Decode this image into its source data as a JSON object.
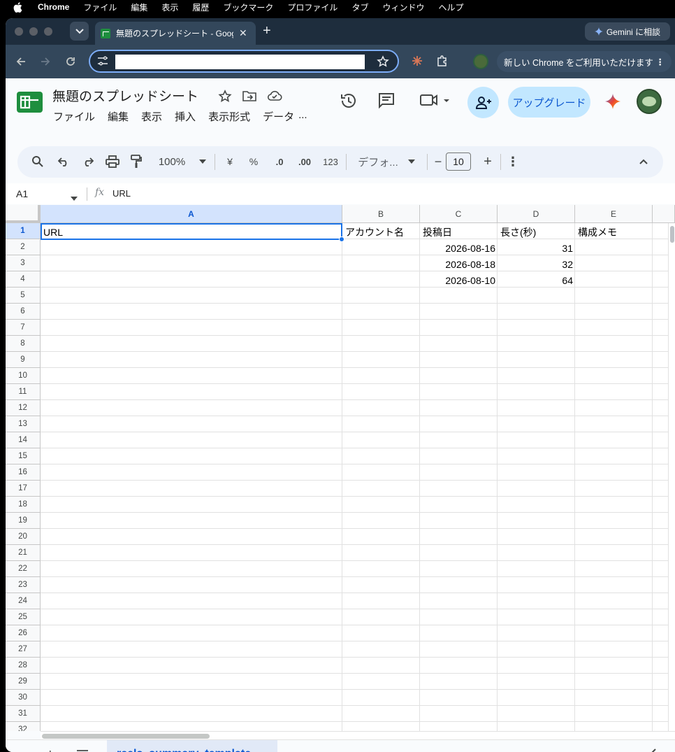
{
  "menubar": {
    "app": "Chrome",
    "items": [
      "ファイル",
      "編集",
      "表示",
      "履歴",
      "ブックマーク",
      "プロファイル",
      "タブ",
      "ウィンドウ",
      "ヘルプ"
    ]
  },
  "browser": {
    "tab_title": "無題のスプレッドシート - Google",
    "gemini_label": "Gemini に相談",
    "address": "",
    "update_label": "新しい Chrome をご利用いただけます"
  },
  "sheets": {
    "doc_title": "無題のスプレッドシート",
    "menus": [
      "ファイル",
      "編集",
      "表示",
      "挿入",
      "表示形式",
      "データ",
      "..."
    ],
    "upgrade_label": "アップグレード",
    "toolbar": {
      "zoom": "100%",
      "currency": "¥",
      "percent": "%",
      "dec_decrease": ".0",
      "dec_increase": ".00",
      "number_format": "123",
      "font": "デフォ...",
      "font_size": "10",
      "minus": "−",
      "plus": "+"
    },
    "formula_bar": {
      "name_box": "A1",
      "fx": "fx",
      "value": "URL"
    },
    "columns": [
      "A",
      "B",
      "C",
      "D",
      "E"
    ],
    "rows": [
      "1",
      "2",
      "3",
      "4",
      "5",
      "6",
      "7",
      "8",
      "9",
      "10",
      "11",
      "12",
      "13",
      "14",
      "15",
      "16",
      "17",
      "18",
      "19",
      "20",
      "21",
      "22",
      "23",
      "24",
      "25",
      "26",
      "27",
      "28",
      "29",
      "30",
      "31",
      "32"
    ],
    "cells": {
      "A1": "URL",
      "B1": "アカウント名",
      "C1": "投稿日",
      "D1": "長さ(秒)",
      "E1": "構成メモ",
      "C2": "2026-08-16",
      "D2": "31",
      "C3": "2026-08-18",
      "D3": "32",
      "C4": "2026-08-10",
      "D4": "64"
    },
    "sheet_tab": "reels_summary_template",
    "colors": {
      "selection": "#1a73e8",
      "header_selected": "#d3e3fd",
      "brand_green": "#1e8e3e",
      "upgrade_bg": "#c2e7ff"
    }
  }
}
